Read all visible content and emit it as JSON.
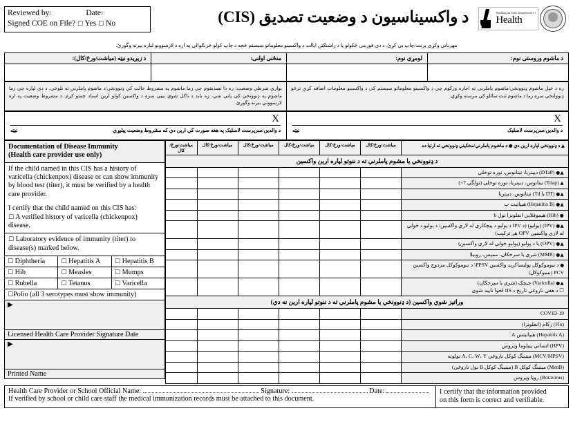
{
  "header": {
    "review_box": {
      "reviewed_by_label": "Reviewed by:",
      "date_label": "Date:",
      "signed_coe_label": "Signed COE on File?",
      "yes_label": "Yes",
      "no_label": "No",
      "checkbox_glyph": "☐"
    },
    "title": "د واکسیناسیون د وضعیت تصدیق (CIS)",
    "logo": {
      "agency_small": "Washington State Department of",
      "agency_large": "Health"
    }
  },
  "intro": "مهرباني وکړی پرنت/چاپ يي کړئ. د دی فورمی ځکولو پا د راشنګتن ایالت د واکسینو معلوماتو سیستم څخه د چاپ کولو څرنګوالي په اره د لارښوونو لپاره بیرته وگورئ.",
  "fields": [
    {
      "label": "د ماشوم وروستی نوم:"
    },
    {
      "label": "لومړی نوم:"
    },
    {
      "label": "منځنی اولنی:"
    },
    {
      "label": "د زیږیدو نیټه (میاشت/ورځ/کال):"
    }
  ],
  "consent": {
    "right_text": "زه د خپل ماشوم ډنوونخي/ماشوم پاملرني ته اجازه ورکوم چي د واکسینو معلوماتو سیستم کي د واکسینو معلومات اضافه کړي ترځو ډنوولنخي سره زما د ماشوم ثبت ساٹلو کي مرسته وکړي.",
    "left_text": "بوازي شرطي وضعیت: زه دا تصدیقوم چي زما ماشوم په مشروط حالت کي ډنوونخي/د ماشوم پاملرني ته نلوخي. د دی لپاره چي زما ماشوم په ډنوونخي کي پاتي شي، زه باید د تاکل شوي نیټي سره د واکسین کولو ارین اسناد چمتو کړم. د مشروط وضعیت په اره لارښووني بیرته وگورئ."
  },
  "signatures": {
    "x_mark": "X",
    "right": {
      "signature_label": "د والدین/سرپرست لاسلیک",
      "date_label": "نیټه"
    },
    "left": {
      "signature_label": "د والدین/سرپرست لاسلیک په هغه صورت کي ارین دي که مشروط وضعیت پیلیړي",
      "date_label": "نیټه"
    }
  },
  "immunity_panel": {
    "heading_line1": "Documentation of Disease Immunity",
    "heading_line2": "(Health care provider use only)",
    "para1": "If the child named in this CIS has a history of varicella (chickenpox) disease or can show immunity by blood test (titer), it must be verified by a health care provider.",
    "para2_intro": "I certify that the child named on this CIS has:",
    "option_varicella": "A verified history of varicella (chickenpox) disease.",
    "option_titer": "Laboratory evidence of immunity (titer) to disease(s) marked below.",
    "checkbox_glyph": "☐",
    "diseases": [
      [
        "Diphtheria",
        "Hepatitis A",
        "Hepatitis B"
      ],
      [
        "Hib",
        "Measles",
        "Mumps"
      ],
      [
        "Rubella",
        "Tetanus",
        "Varicella"
      ]
    ],
    "polio": "Polio (all 3 serotypes must show immunity)",
    "provider_signature_caption": "Licensed Health Care Provider Signature  Date",
    "printed_name_caption": "Printed Name",
    "arrow_glyph": "▶"
  },
  "vaccine_table": {
    "header": {
      "left_label_a": "د ډنوونخي لپاره ارین دي",
      "left_label_b": "د ماشوم پاملرني/مخکيني ډنوونخي ته ارتيا ده",
      "date_col": "میاشت/ورځ/کال"
    },
    "section1_title": "د ډنوونخي یا مشوم پاملرني ته د ننوتو لپاره ارین واکسین",
    "section1_rows": [
      {
        "marks": "▲●",
        "text": "(DTaP) دیپتریا، تیتانوس، توره توخلي"
      },
      {
        "marks": "▲",
        "text": "(Tdap) تیتانوس، دیپتریا، توره توخلي (تولگي 7+)"
      },
      {
        "marks": "▲●",
        "text": "(DT یا Td) تیتانوس، دیپتریا"
      },
      {
        "marks": "▲●",
        "text": "(Hepatitis B) هیپاتیت ب"
      },
      {
        "marks": "●",
        "text": "(Hib) هیموفلایي انفلونزا نول b"
      },
      {
        "marks": "▲●",
        "text": "(IPV) (پولیو) (د IPV د پولیو د پیچکاري له لاري واکسین/ د پولیو د خولي له لاري واکسین OPV هر ترکیب)"
      },
      {
        "marks": "▲●",
        "text": "(OPV) یا د پولیو (پولیو خولي له لاري واکسین)"
      },
      {
        "marks": "▲●",
        "text": "(MMR) شري یا سرخکان، ممپس، روبیلا"
      },
      {
        "marks": "●",
        "text": "د نیوموکوکل پولیساکرید واکسین PPSV\\ د نیوموکوکل مزدوج واکسین PCV (نیموکوکل)"
      },
      {
        "marks": "▲●",
        "text": "(Varicella) چیچک (شري یا سرخکان)"
      },
      {
        "marks": "☐",
        "text": "د هغي ناروغي تاریخ د IIS لخوا تایید شوی"
      }
    ],
    "section2_title": "وراتیز شوي واکسین (د ډنوونخي یا مشوم پاملرني ته د ننوتو لپاره ارین نه دي)",
    "section2_rows": [
      {
        "marks": "",
        "text": "COVID-19"
      },
      {
        "marks": "",
        "text": "(Flu) زکام (انفلونزا)"
      },
      {
        "marks": "",
        "text": "(Hepatitis A) هیپاتیتس A"
      },
      {
        "marks": "",
        "text": "(HPV) انساني پیپلوما ویروس"
      },
      {
        "marks": "",
        "text": "(MCV/MPSV) مینینگ کوکل ناروغي A، C، W، Y نولونه"
      },
      {
        "marks": "",
        "text": "(MenB) مینینگ کوکل B (مینینگ کوکل B نول ناروغي)"
      },
      {
        "marks": "",
        "text": "(Rotavirus) روټا ویروس"
      }
    ]
  },
  "footer": {
    "provider_label": "Health Care Provider or School Official Name:",
    "verified_note": "If verified by school or child care staff the medical immunization records must be attached to this document.",
    "signature_label": "Signature:",
    "date_label": "Date:",
    "certify_line1": "I certify that the information provided",
    "certify_line2": "on this form is correct and verifiable."
  }
}
